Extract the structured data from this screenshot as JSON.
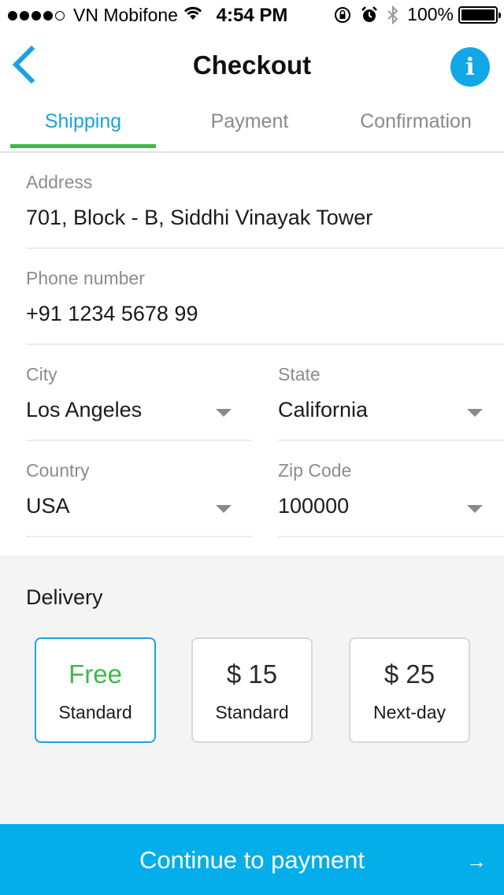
{
  "status_bar": {
    "carrier": "VN Mobifone",
    "time": "4:54 PM",
    "battery": "100%",
    "signal_icon": "signal-dots-icon",
    "wifi_icon": "wifi-icon"
  },
  "nav": {
    "title": "Checkout",
    "back_icon": "chevron-left-icon",
    "info_icon_glyph": "i"
  },
  "tabs": [
    {
      "label": "Shipping",
      "active": true
    },
    {
      "label": "Payment",
      "active": false
    },
    {
      "label": "Confirmation",
      "active": false
    }
  ],
  "form": {
    "address": {
      "label": "Address",
      "value": "701, Block -  B, Siddhi Vinayak Tower"
    },
    "phone": {
      "label": "Phone number",
      "value": "+91 1234 5678 99"
    },
    "city": {
      "label": "City",
      "value": "Los Angeles"
    },
    "state": {
      "label": "State",
      "value": "California"
    },
    "country": {
      "label": "Country",
      "value": "USA"
    },
    "zip": {
      "label": "Zip Code",
      "value": "100000"
    }
  },
  "delivery": {
    "title": "Delivery",
    "options": [
      {
        "price": "Free",
        "name": "Standard",
        "selected": true
      },
      {
        "price": "$ 15",
        "name": "Standard",
        "selected": false
      },
      {
        "price": "$ 25",
        "name": "Next-day",
        "selected": false
      }
    ]
  },
  "continue_button": {
    "label": "Continue to payment",
    "arrow": "→"
  },
  "colors": {
    "accent": "#03aeea",
    "tab_active": "#1aa3e0",
    "indicator": "#3db94a",
    "free_text": "#3db94a"
  }
}
